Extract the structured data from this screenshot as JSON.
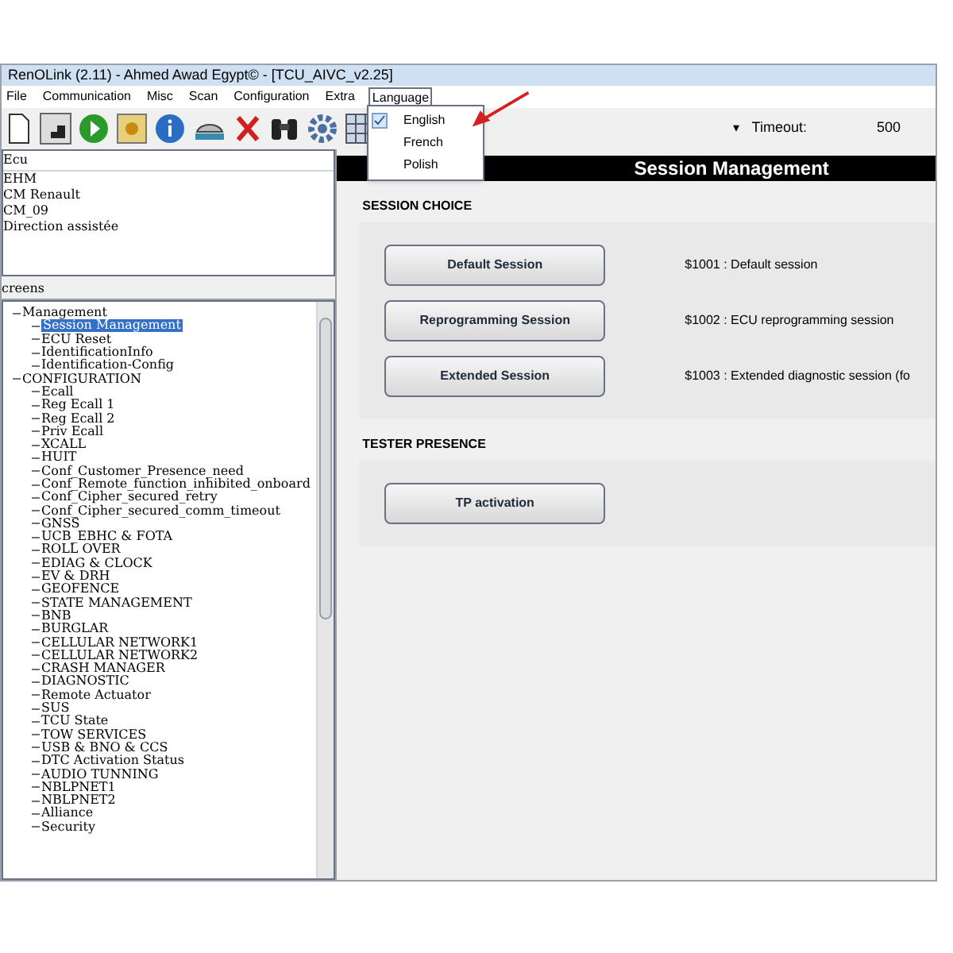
{
  "window": {
    "title": "RenOLink (2.11) - Ahmed Awad Egypt© - [TCU_AIVC_v2.25]"
  },
  "menu": [
    {
      "label": "File",
      "open": false
    },
    {
      "label": "Communication",
      "open": false
    },
    {
      "label": "Misc",
      "open": false
    },
    {
      "label": "Scan",
      "open": false
    },
    {
      "label": "Configuration",
      "open": false
    },
    {
      "label": "Extra",
      "open": false
    },
    {
      "label": "Language",
      "open": true
    }
  ],
  "language_menu": [
    {
      "label": "English",
      "checked": true
    },
    {
      "label": "French",
      "checked": false
    },
    {
      "label": "Polish",
      "checked": false
    }
  ],
  "timeout": {
    "caret": "▾",
    "label": "Timeout:",
    "value": "500"
  },
  "ecu_list": {
    "header": "Ecu",
    "items": [
      "EHM",
      "CM Renault",
      "CM_09",
      "Direction assistée"
    ]
  },
  "screens": {
    "header": "creens",
    "tree": [
      {
        "label": "Management",
        "selected": false,
        "children": [
          {
            "label": "Session Management",
            "selected": true
          },
          {
            "label": "ECU Reset",
            "selected": false
          },
          {
            "label": "IdentificationInfo",
            "selected": false
          },
          {
            "label": "Identification-Config",
            "selected": false
          }
        ]
      },
      {
        "label": "CONFIGURATION",
        "selected": false,
        "children": [
          {
            "label": "Ecall",
            "selected": false
          },
          {
            "label": "Reg Ecall 1",
            "selected": false
          },
          {
            "label": "Reg Ecall 2",
            "selected": false
          },
          {
            "label": "Priv Ecall",
            "selected": false
          },
          {
            "label": "XCALL",
            "selected": false
          },
          {
            "label": "HUIT",
            "selected": false
          },
          {
            "label": "Conf_Customer_Presence_need",
            "selected": false
          },
          {
            "label": "Conf_Remote_function_inhibited_onboard",
            "selected": false
          },
          {
            "label": "Conf_Cipher_secured_retry",
            "selected": false
          },
          {
            "label": "Conf_Cipher_secured_comm_timeout",
            "selected": false
          },
          {
            "label": "GNSS",
            "selected": false
          },
          {
            "label": "UCB_EBHC & FOTA",
            "selected": false
          },
          {
            "label": "ROLL OVER",
            "selected": false
          },
          {
            "label": "EDIAG & CLOCK",
            "selected": false
          },
          {
            "label": "EV & DRH",
            "selected": false
          },
          {
            "label": "GEOFENCE",
            "selected": false
          },
          {
            "label": "STATE MANAGEMENT",
            "selected": false
          },
          {
            "label": "BNB",
            "selected": false
          },
          {
            "label": "BURGLAR",
            "selected": false
          },
          {
            "label": "CELLULAR NETWORK1",
            "selected": false
          },
          {
            "label": "CELLULAR NETWORK2",
            "selected": false
          },
          {
            "label": "CRASH MANAGER",
            "selected": false
          },
          {
            "label": "DIAGNOSTIC",
            "selected": false
          },
          {
            "label": "Remote Actuator",
            "selected": false
          },
          {
            "label": "SUS",
            "selected": false
          },
          {
            "label": "TCU State",
            "selected": false
          },
          {
            "label": "TOW SERVICES",
            "selected": false
          },
          {
            "label": "USB & BNO & CCS",
            "selected": false
          },
          {
            "label": "DTC Activation Status",
            "selected": false
          },
          {
            "label": "AUDIO TUNNING",
            "selected": false
          },
          {
            "label": "NBLPNET1",
            "selected": false
          },
          {
            "label": "NBLPNET2",
            "selected": false
          },
          {
            "label": "Alliance",
            "selected": false
          },
          {
            "label": "Security",
            "selected": false
          }
        ]
      }
    ]
  },
  "panel": {
    "title": "Session Management",
    "sections": [
      {
        "title": "SESSION CHOICE",
        "rows": [
          {
            "button": "Default Session",
            "description": "$1001 : Default session"
          },
          {
            "button": "Reprogramming Session",
            "description": "$1002 : ECU reprogramming session"
          },
          {
            "button": "Extended Session",
            "description": "$1003 : Extended diagnostic session (fo"
          }
        ]
      },
      {
        "title": "TESTER PRESENCE",
        "rows": [
          {
            "button": "TP activation"
          }
        ]
      }
    ]
  }
}
